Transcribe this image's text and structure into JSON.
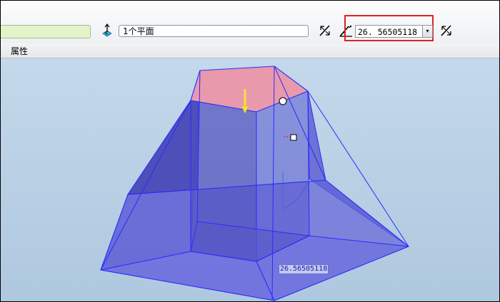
{
  "toolbar": {
    "plane_selection": "1个平面",
    "angle_value": "26. 56505118",
    "dropdown_glyph": "▾",
    "icons": [
      "flip-direction-icon",
      "swap-icon",
      "angle-mode-icon",
      "swap-icon"
    ]
  },
  "tabs": {
    "properties": "属性"
  },
  "viewport": {
    "dimension_label": "26.56505118"
  },
  "colors": {
    "highlight_box": "#e0202a",
    "top_face": "#e89aac",
    "body_face": "#5a5ad0",
    "edge": "#2b2bff",
    "arrow": "#f5e23a"
  }
}
